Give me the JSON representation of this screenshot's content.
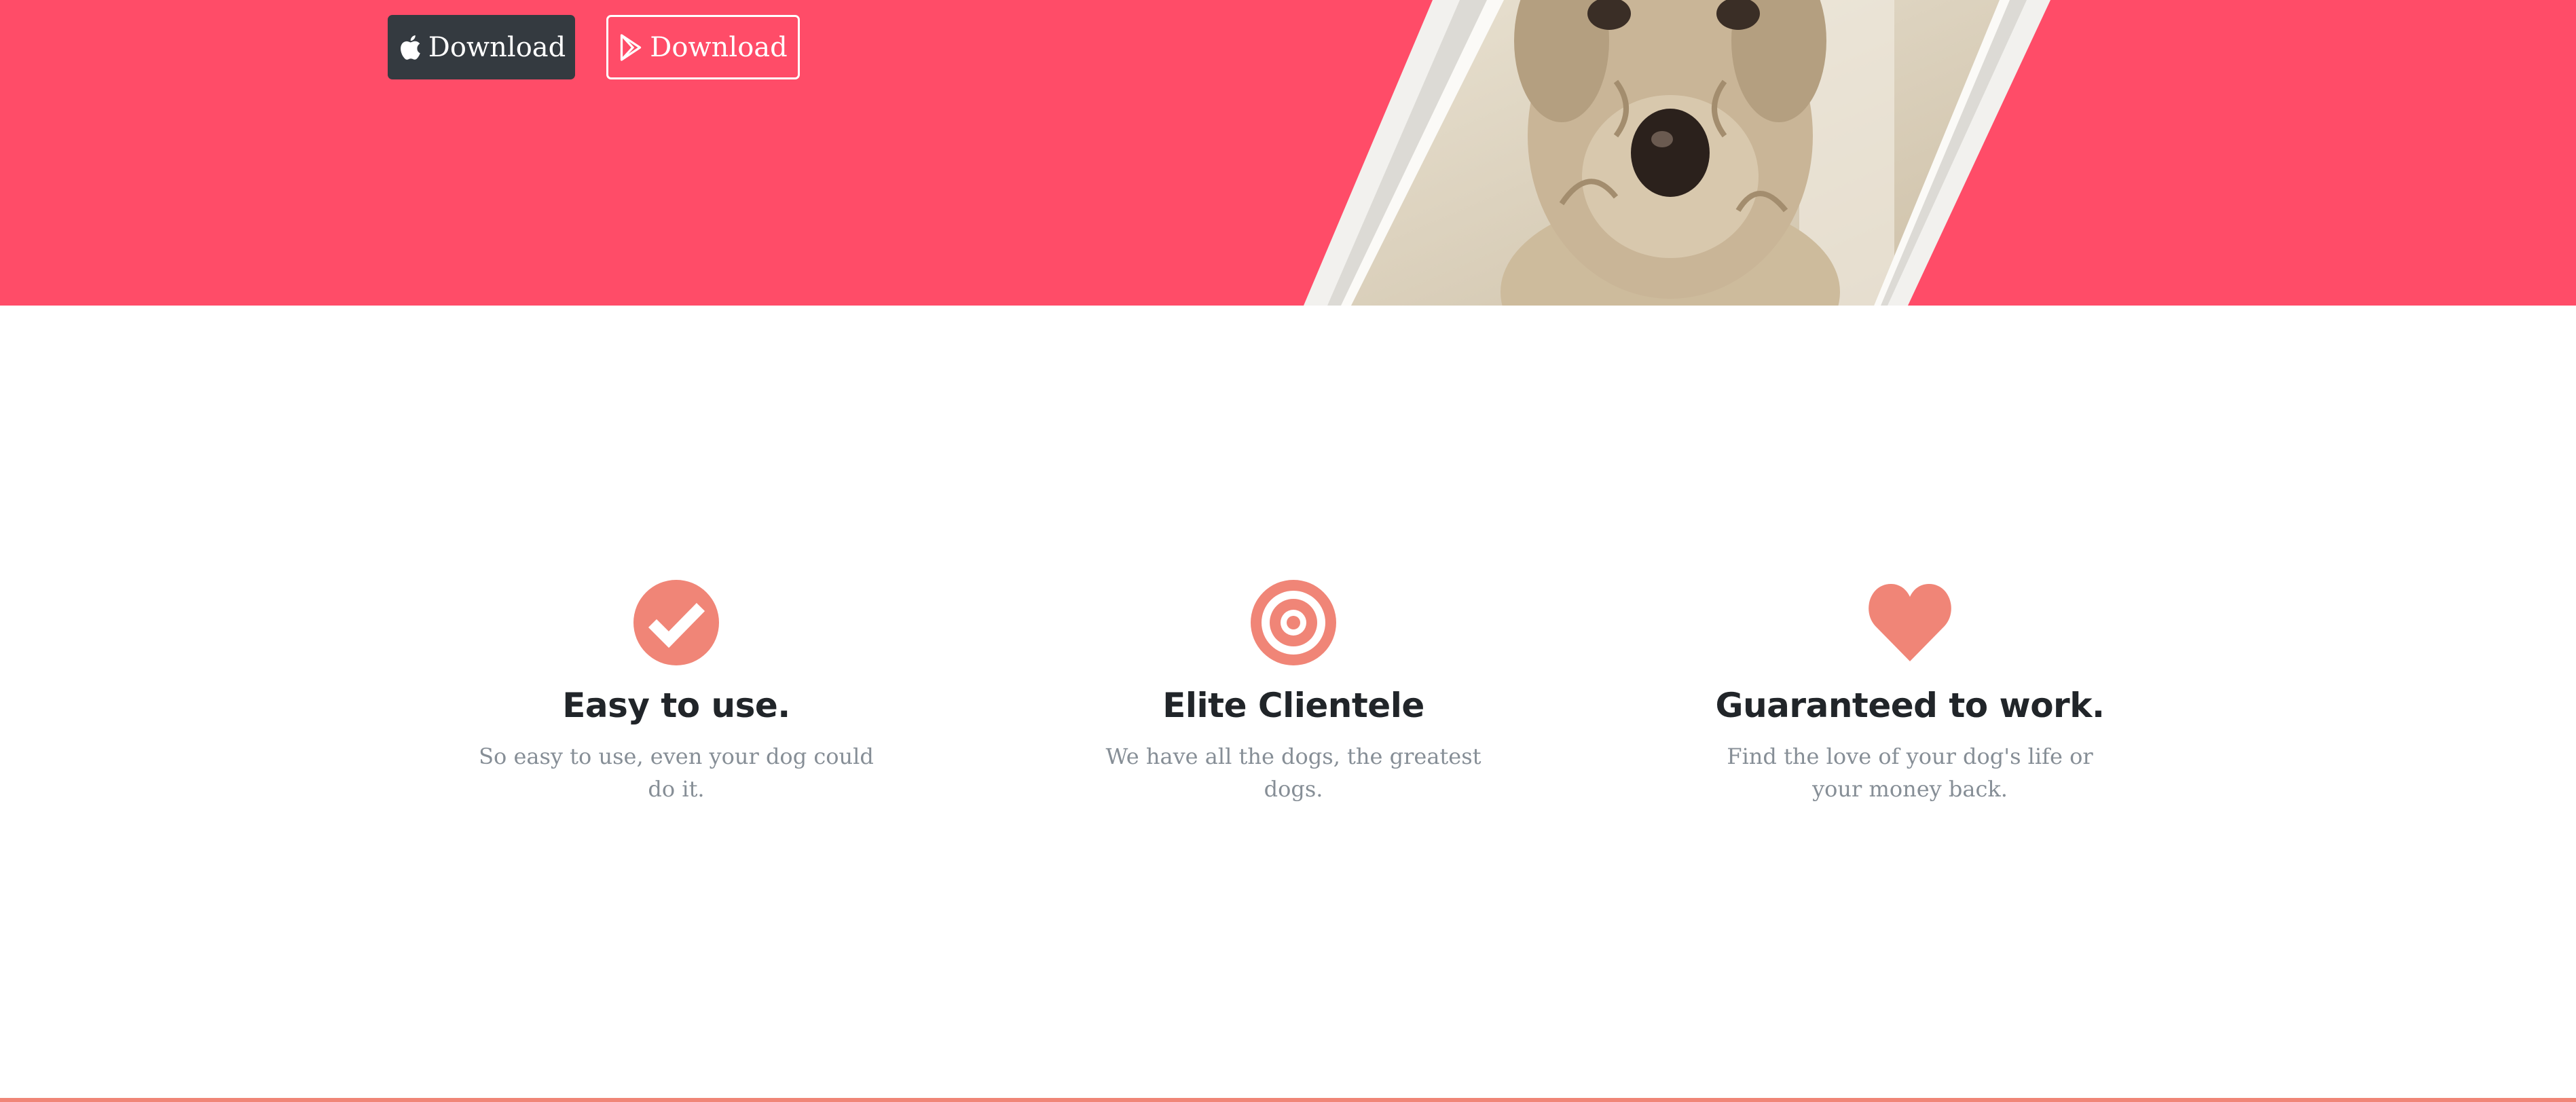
{
  "hero": {
    "background_color": "#ff4c68",
    "buttons": [
      {
        "label": "Download",
        "icon": "apple-icon",
        "style": "dark",
        "color": "#343a40"
      },
      {
        "label": "Download",
        "icon": "google-play-icon",
        "style": "outline"
      }
    ],
    "phone_image": "dog-photo"
  },
  "features": {
    "accent_color": "#f08577",
    "items": [
      {
        "icon": "check-circle-icon",
        "title": "Easy to use.",
        "description": "So easy to use, even your dog could do it."
      },
      {
        "icon": "target-icon",
        "title": "Elite Clientele",
        "description": "We have all the dogs, the greatest dogs."
      },
      {
        "icon": "heart-icon",
        "title": "Guaranteed to work.",
        "description": "Find the love of your dog's life or your money back."
      }
    ]
  }
}
